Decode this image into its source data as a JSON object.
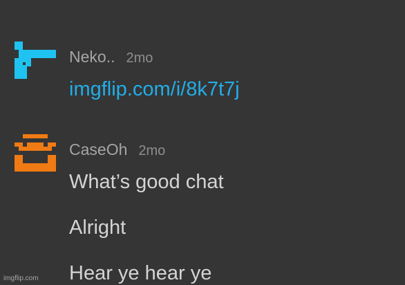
{
  "comments": [
    {
      "username": "Neko..",
      "time": "2mo",
      "avatar_icon": "pistol-pixel-icon",
      "avatar_color": "#1ec3f2",
      "message": "imgflip.com/i/8k7t7j"
    },
    {
      "username": "CaseOh",
      "time": "2mo",
      "avatar_icon": "face-pixel-icon",
      "avatar_color": "#f07b14",
      "messages": [
        "What’s good chat",
        "Alright",
        "Hear ye hear ye"
      ]
    }
  ],
  "watermark": "imgflip.com"
}
